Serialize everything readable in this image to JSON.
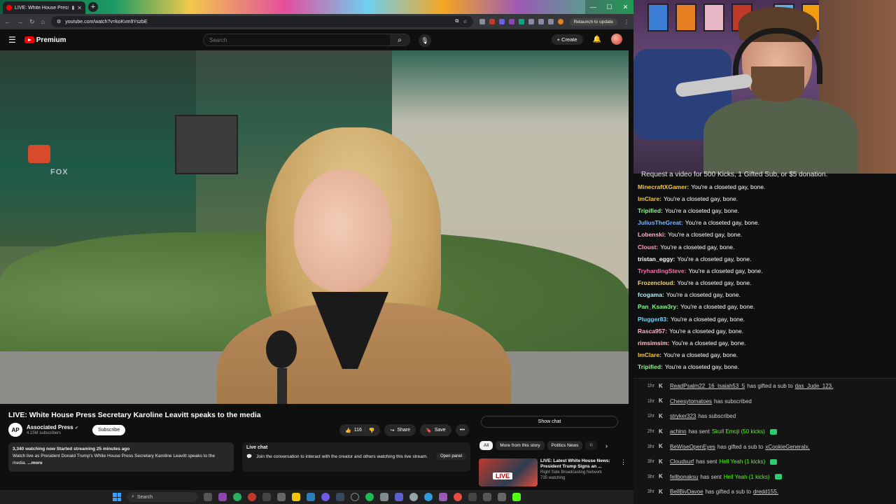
{
  "browser": {
    "tab_title": "LIVE: White House Press Se",
    "url": "youtube.com/watch?v=koKvm9YszbE",
    "relaunch_label": "Relaunch to update"
  },
  "youtube": {
    "logo_text": "Premium",
    "search_placeholder": "Search",
    "create_label": "Create",
    "video_title": "LIVE: White House Press Secretary Karoline Leavitt speaks to the media",
    "channel_name": "Associated Press",
    "channel_avatar": "AP",
    "subscribers": "4.15M subscribers",
    "subscribe_label": "Subscribe",
    "likes": "116",
    "share_label": "Share",
    "save_label": "Save",
    "stats_line": "3,340 watching now  Started streaming 25 minutes ago",
    "description": "Watch live as President Donald Trump's White House Press Secretary Karoline Leavitt speaks to the media.",
    "more_label": "...more",
    "live_chat_title": "Live chat",
    "live_chat_text": "Join the conversation to interact with the creator and others watching this live stream.",
    "open_panel_label": "Open panel",
    "show_chat_label": "Show chat",
    "chips": [
      "All",
      "More from this story",
      "Politics News",
      "R"
    ],
    "recommended": {
      "badge": "LIVE",
      "title": "LIVE: Latest White House News: President Trump Signs an ...",
      "channel": "Right Side Broadcasting Network",
      "viewers": "735 watching"
    },
    "video_overlay_text": "FOX"
  },
  "stream": {
    "banner": "Request a video for 500 Kicks, 1 Gifted Sub, or $5 donation.",
    "chat": [
      {
        "user": "MinecraftXGamer:",
        "text": "You're a closeted gay, bone.",
        "color": "#f2c94c"
      },
      {
        "user": "ImClare:",
        "text": "You're a closeted gay, bone.",
        "color": "#f5c542"
      },
      {
        "user": "Tripified:",
        "text": "You're a closeted gay, bone.",
        "color": "#8ef58e"
      },
      {
        "user": "JuliusTheGreat:",
        "text": "You're a closeted gay, bone.",
        "color": "#7ab8ff"
      },
      {
        "user": "Lobenski:",
        "text": "You're a closeted gay, bone.",
        "color": "#ffb3c7"
      },
      {
        "user": "Cloust:",
        "text": "You're a closeted gay, bone.",
        "color": "#ff9ec4"
      },
      {
        "user": "tristan_eggy:",
        "text": "You're a closeted gay, bone.",
        "color": "#ffffff"
      },
      {
        "user": "TryhardingSteve:",
        "text": "You're a closeted gay, bone.",
        "color": "#ff6fa8"
      },
      {
        "user": "Frozencloud:",
        "text": "You're a closeted gay, bone.",
        "color": "#f7d774"
      },
      {
        "user": "fcogama:",
        "text": "You're a closeted gay, bone.",
        "color": "#b8f0ff"
      },
      {
        "user": "Pan_Ksaw3ry:",
        "text": "You're a closeted gay, bone.",
        "color": "#7dff8a"
      },
      {
        "user": "Plugger83:",
        "text": "You're a closeted gay, bone.",
        "color": "#6fd6ff"
      },
      {
        "user": "Rasca957:",
        "text": "You're a closeted gay, bone.",
        "color": "#ffb3d1"
      },
      {
        "user": "rimsimsim:",
        "text": "You're a closeted gay, bone.",
        "color": "#ffc0cb"
      },
      {
        "user": "ImClare:",
        "text": "You're a closeted gay, bone.",
        "color": "#f5c542"
      },
      {
        "user": "Tripified:",
        "text": "You're a closeted gay, bone.",
        "color": "#8ef58e"
      }
    ],
    "events": [
      {
        "time": "1hr",
        "user": "ReadPsalm22_16_Isaiah53_5",
        "action": "has gifted a sub to",
        "target": "das_Jude_123.",
        "gift": ""
      },
      {
        "time": "1hr",
        "user": "Cheesytomatoes",
        "action": "has subscribed",
        "target": "",
        "gift": ""
      },
      {
        "time": "1hr",
        "user": "stryker323",
        "action": "has subscribed",
        "target": "",
        "gift": ""
      },
      {
        "time": "2hr",
        "user": "achinn",
        "action": "has sent",
        "target": "",
        "gift": "Skull Emoji (50 kicks)"
      },
      {
        "time": "3hr",
        "user": "BeWiseOpenEyes",
        "action": "has gifted a sub to",
        "target": "xCookieGeneralx.",
        "gift": ""
      },
      {
        "time": "3hr",
        "user": "Cloudsurf",
        "action": "has sent",
        "target": "",
        "gift": "Hell Yeah (1 kicks)"
      },
      {
        "time": "3hr",
        "user": "fellbonaksu",
        "action": "has sent",
        "target": "",
        "gift": "Hell Yeah (1 kicks)"
      },
      {
        "time": "3hr",
        "user": "BellBivDavoe",
        "action": "has gifted a sub to",
        "target": "dredd155.",
        "gift": ""
      }
    ]
  },
  "taskbar": {
    "search_placeholder": "Search"
  }
}
